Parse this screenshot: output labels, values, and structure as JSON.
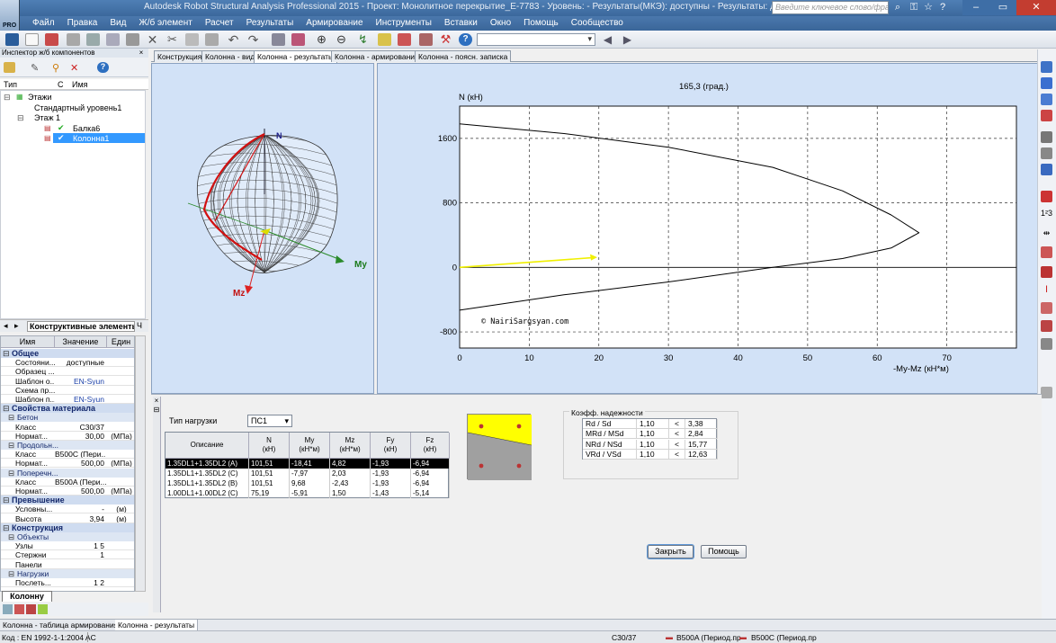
{
  "window": {
    "title": "Autodesk Robot Structural Analysis Professional 2015 - Проект: Монолитное перекрытие_Е-7783 - Уровень:  - Результаты(МКЭ): доступны - Результаты: доступные",
    "search_placeholder": "Введите ключевое слово/фразу",
    "logo_text": "PRO"
  },
  "menu": [
    "Файл",
    "Правка",
    "Вид",
    "Ж/б элемент",
    "Расчет",
    "Результаты",
    "Армирование",
    "Инструменты",
    "Вставки",
    "Окно",
    "Помощь",
    "Сообщество"
  ],
  "inspector": {
    "title": "Инспектор ж/б компонентов",
    "close": "×",
    "columns": {
      "type": "Тип",
      "c": "С",
      "name": "Имя"
    },
    "tree": {
      "root": "Этажи",
      "std_level": "Стандартный уровень1",
      "floor": "Этаж 1",
      "beam": "Балка6",
      "column": "Колонна1"
    },
    "tabs": {
      "active": "Конструктивные элементы",
      "next": "Ч"
    }
  },
  "props": {
    "headers": {
      "name": "Имя",
      "value": "Значение",
      "unit": "Един"
    },
    "rows": [
      {
        "kind": "g1",
        "name": "Общее"
      },
      {
        "kind": "r",
        "name": "Состояни...",
        "value": "доступные",
        "unit": ""
      },
      {
        "kind": "r",
        "name": "Образец ...",
        "value": "",
        "unit": ""
      },
      {
        "kind": "r",
        "name": "Шаблон о...",
        "value": "EN-Syun",
        "unit": "",
        "blue": true
      },
      {
        "kind": "r",
        "name": "Схема пр...",
        "value": "",
        "unit": ""
      },
      {
        "kind": "r",
        "name": "Шаблон п...",
        "value": "EN-Syun",
        "unit": "",
        "blue": true
      },
      {
        "kind": "g1",
        "name": "Свойства материала"
      },
      {
        "kind": "g2",
        "name": "Бетон"
      },
      {
        "kind": "r",
        "name": "Класс",
        "value": "C30/37",
        "unit": ""
      },
      {
        "kind": "r",
        "name": "Нормат...",
        "value": "30,00",
        "unit": "(МПа)"
      },
      {
        "kind": "g2",
        "name": "Продольн..."
      },
      {
        "kind": "r",
        "name": "Класс",
        "value": "B500C (Пери...",
        "unit": ""
      },
      {
        "kind": "r",
        "name": "Нормат...",
        "value": "500,00",
        "unit": "(МПа)"
      },
      {
        "kind": "g2",
        "name": "Поперечн..."
      },
      {
        "kind": "r",
        "name": "Класс",
        "value": "B500A (Пери...",
        "unit": ""
      },
      {
        "kind": "r",
        "name": "Нормат...",
        "value": "500,00",
        "unit": "(МПа)"
      },
      {
        "kind": "g1",
        "name": "Превышение"
      },
      {
        "kind": "r",
        "name": "Условны...",
        "value": "-",
        "unit": "(м)"
      },
      {
        "kind": "r",
        "name": "Высота",
        "value": "3,94",
        "unit": "(м)"
      },
      {
        "kind": "g1",
        "name": "Конструкция"
      },
      {
        "kind": "g2",
        "name": "Объекты"
      },
      {
        "kind": "r",
        "name": "Узлы",
        "value": "1 5",
        "unit": ""
      },
      {
        "kind": "r",
        "name": "Стержни",
        "value": "1",
        "unit": ""
      },
      {
        "kind": "r",
        "name": "Панели",
        "value": "",
        "unit": ""
      },
      {
        "kind": "g2",
        "name": "Нагрузки"
      },
      {
        "kind": "r",
        "name": "Послеть...",
        "value": "1 2",
        "unit": ""
      }
    ],
    "bottom_tab": "Колонну"
  },
  "doc_tabs": [
    "Конструкция",
    "Колонна - вид",
    "Колонна - результаты",
    "Колонна - армирование",
    "Колонна - поясн. записка"
  ],
  "view3d": {
    "axis_n": "N",
    "axis_my": "My",
    "axis_mz": "Mz"
  },
  "chart_data": {
    "type": "line",
    "title": "165,3 (град.)",
    "ylabel": "N (кН)",
    "xlabel": "-My-Mz (кН*м)",
    "xlim": [
      0,
      80
    ],
    "ylim": [
      -1000,
      2000
    ],
    "x_ticks": [
      0,
      10,
      20,
      30,
      40,
      50,
      60,
      70
    ],
    "y_ticks": [
      -800,
      0,
      800,
      1600
    ],
    "grid": true,
    "watermark": "© NairiSargsyan.com",
    "series": [
      {
        "x": [
          0,
          15,
          30,
          45,
          55,
          62,
          66,
          62,
          55,
          45,
          30,
          15,
          0
        ],
        "y": [
          1780,
          1660,
          1490,
          1240,
          950,
          650,
          430,
          240,
          110,
          0,
          -180,
          -340,
          -530
        ]
      }
    ],
    "load_vector": {
      "x": [
        0,
        19
      ],
      "y": [
        0,
        120
      ]
    }
  },
  "load_panel": {
    "type_label": "Тип нагрузки",
    "type_value": "ПС1",
    "headers": [
      "Описание",
      "N\n(кН)",
      "My\n(кН*м)",
      "Mz\n(кН*м)",
      "Fy\n(кН)",
      "Fz\n(кН)"
    ],
    "rows": [
      [
        "1.35DL1+1.35DL2 (A)",
        "101,51",
        "-18,41",
        "4,82",
        "-1,93",
        "-6,94"
      ],
      [
        "1.35DL1+1.35DL2 (C)",
        "101,51",
        "-7,97",
        "2,03",
        "-1,93",
        "-6,94"
      ],
      [
        "1.35DL1+1.35DL2 (B)",
        "101,51",
        "9,68",
        "-2,43",
        "-1,93",
        "-6,94"
      ],
      [
        "1.00DL1+1.00DL2 (C)",
        "75,19",
        "-5,91",
        "1,50",
        "-1,43",
        "-5,14"
      ]
    ]
  },
  "safety": {
    "title": "Коэфф. надежности",
    "rows": [
      [
        "Rd / Sd",
        "1,10",
        "<",
        "3,38"
      ],
      [
        "MRd / MSd",
        "1,10",
        "<",
        "2,84"
      ],
      [
        "NRd / NSd",
        "1,10",
        "<",
        "15,77"
      ],
      [
        "VRd / VSd",
        "1,10",
        "<",
        "12,63"
      ]
    ]
  },
  "buttons": {
    "close": "Закрыть",
    "help": "Помощь"
  },
  "window_tabs": [
    "Колонна - таблица армирования",
    "Колонна - результаты"
  ],
  "status": {
    "code": "Код : EN 1992-1-1:2004 AC",
    "concrete": "C30/37",
    "trans": "B500A (Период.пр",
    "long": "B500C (Период.пр"
  },
  "colors": {
    "accent": "#3b689c",
    "panel": "#d2e2f7",
    "curve": "#000000",
    "vector": "#f0f000",
    "selected_row": "#000000"
  }
}
